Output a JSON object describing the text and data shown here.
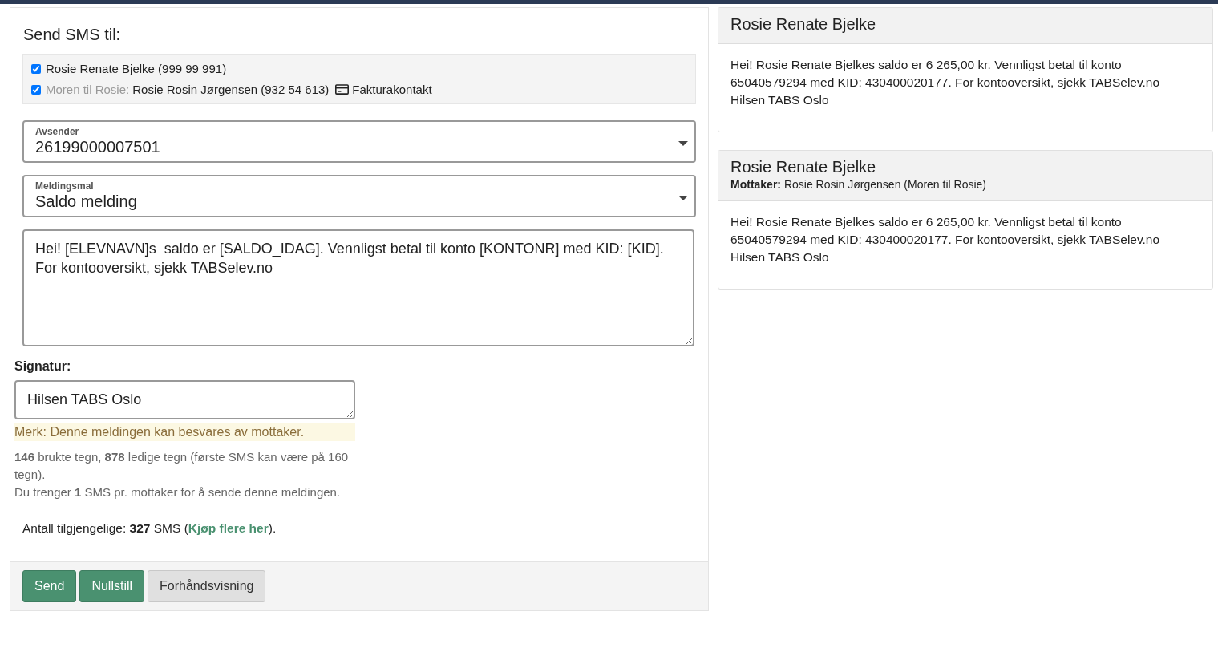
{
  "form": {
    "heading": "Send SMS til:",
    "recipients": [
      {
        "checked": true,
        "name": "Rosie Renate Bjelke (999 99 991)"
      },
      {
        "checked": true,
        "prefix": "Moren til Rosie:",
        "name": "Rosie Rosin Jørgensen (932 54 613)",
        "tag": "Fakturakontakt"
      }
    ],
    "sender": {
      "label": "Avsender",
      "value": "26199000007501"
    },
    "template": {
      "label": "Meldingsmal",
      "value": "Saldo melding"
    },
    "message": {
      "value": "Hei! [ELEVNAVN]s  saldo er [SALDO_IDAG]. Vennligst betal til konto [KONTONR] med KID: [KID]. For kontooversikt, sjekk TABSelev.no"
    },
    "signature": {
      "label": "Signatur:",
      "value": "Hilsen TABS Oslo"
    },
    "note": "Merk: Denne meldingen kan besvares av mottaker.",
    "usage": [
      "**146** brukte tegn, **878** ledige tegn (første SMS kan være på 160 tegn).",
      "Du trenger **1** SMS pr. mottaker for å sende denne meldingen."
    ],
    "available": {
      "text": "Antall tilgjengelige: **327** SMS (",
      "link": "Kjøp flere her",
      "after": ")."
    },
    "buttons": [
      {
        "label": "Send",
        "kind": "primary"
      },
      {
        "label": "Nullstill",
        "kind": "primary"
      },
      {
        "label": "Forhåndsvisning",
        "kind": "default"
      }
    ]
  },
  "previews": [
    {
      "title": "Rosie Renate Bjelke",
      "body": "Hei! Rosie Renate Bjelkes saldo er 6 265,00 kr. Vennligst betal til konto 65040579294 med KID: 430400020177. For kontooversikt, sjekk TABSelev.no",
      "signature": "Hilsen TABS Oslo"
    },
    {
      "title": "Rosie Renate Bjelke",
      "recipient": "**Mottaker:** Rosie Rosin Jørgensen (Moren til Rosie)",
      "body": "Hei! Rosie Renate Bjelkes saldo er 6 265,00 kr. Vennligst betal til konto 65040579294 med KID: 430400020177. For kontooversikt, sjekk TABSelev.no",
      "signature": "Hilsen TABS Oslo"
    }
  ]
}
